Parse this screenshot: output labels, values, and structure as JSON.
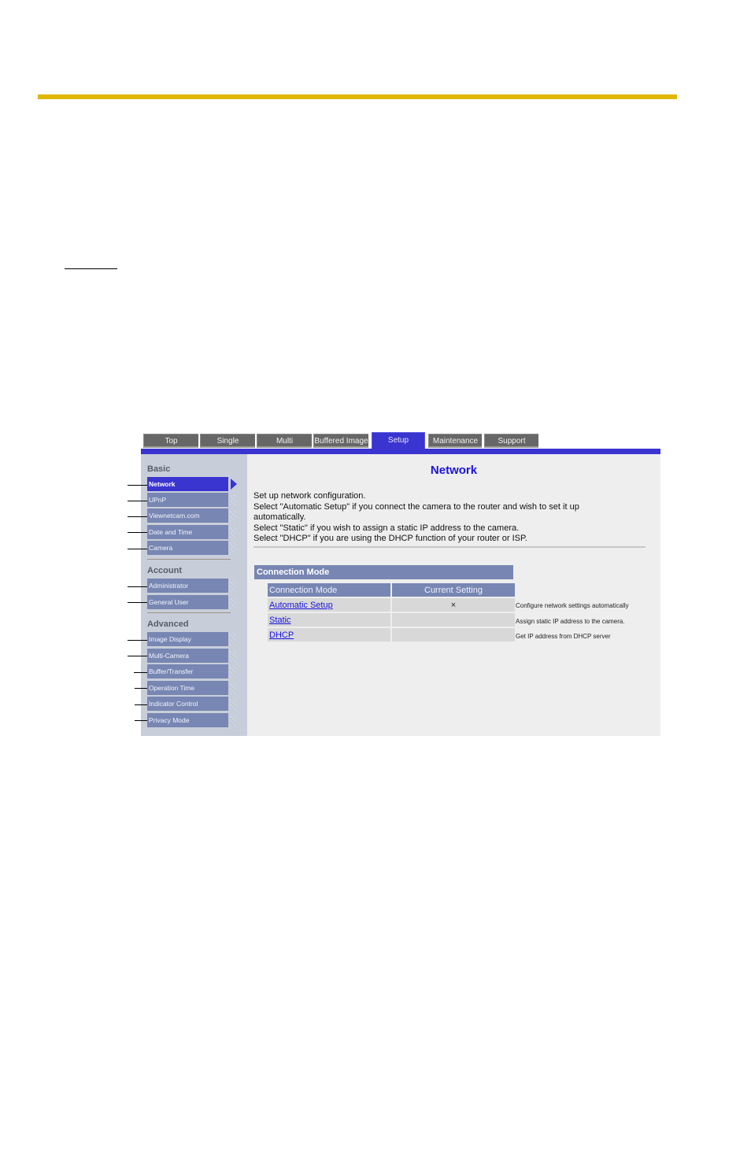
{
  "tabs": [
    {
      "label": "Top",
      "active": false
    },
    {
      "label": "Single",
      "active": false
    },
    {
      "label": "Multi",
      "active": false
    },
    {
      "label": "Buffered Image",
      "active": false
    },
    {
      "label": "Setup",
      "active": true
    },
    {
      "label": "Maintenance",
      "active": false
    },
    {
      "label": "Support",
      "active": false
    }
  ],
  "sidebar": {
    "sections": [
      {
        "label": "Basic",
        "items": [
          "Network",
          "UPnP",
          "Viewnetcam.com",
          "Date and Time",
          "Camera"
        ]
      },
      {
        "label": "Account",
        "items": [
          "Administrator",
          "General User"
        ]
      },
      {
        "label": "Advanced",
        "items": [
          "Image Display",
          "Multi-Camera",
          "Buffer/Transfer",
          "Operation Time",
          "Indicator Control",
          "Privacy Mode"
        ]
      }
    ],
    "active_item": "Network"
  },
  "main": {
    "title": "Network",
    "description": [
      "Set up network configuration.",
      "Select \"Automatic Setup\" if you connect the camera to the router and wish to set it up automatically.",
      "Select \"Static\" if you wish to assign a static IP address to the camera.",
      "Select \"DHCP\" if you are using the DHCP function of your router or ISP."
    ],
    "connection_mode": {
      "header": "Connection Mode",
      "columns": [
        "Connection Mode",
        "Current Setting"
      ],
      "rows": [
        {
          "mode": "Automatic Setup",
          "current": "×",
          "note": "Configure network settings automatically"
        },
        {
          "mode": "Static",
          "current": "",
          "note": "Assign static IP address to the camera."
        },
        {
          "mode": "DHCP",
          "current": "",
          "note": "Get IP address from DHCP server"
        }
      ]
    }
  },
  "colors": {
    "accent": "#3a34d0",
    "gold_rule": "#dfb700",
    "nav_item": "#7786b2",
    "title": "#1a14e0"
  }
}
